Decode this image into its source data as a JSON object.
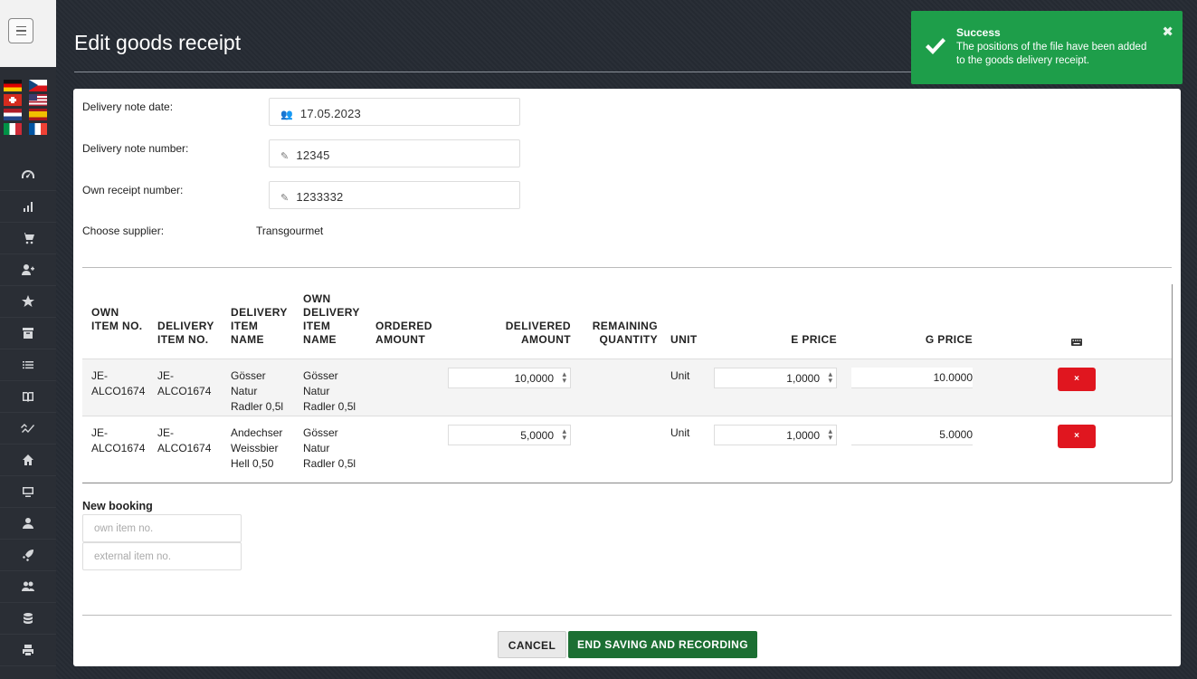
{
  "header": {
    "title": "Edit goods receipt"
  },
  "toast": {
    "title": "Success",
    "message": "The positions of the file have been added to the goods delivery receipt.",
    "close": "✖"
  },
  "sidebar": {
    "flags": [
      "de",
      "cz",
      "ch",
      "us",
      "nl",
      "es",
      "it",
      "fr"
    ],
    "icons": [
      "dashboard-icon",
      "chart-icon",
      "cart-icon",
      "add-user-icon",
      "star-icon",
      "archive-icon",
      "list-icon",
      "book-icon",
      "trend-icon",
      "home-icon",
      "monitor-icon",
      "user-icon",
      "rocket-icon",
      "users-icon",
      "database-icon",
      "print-icon"
    ]
  },
  "form": {
    "delivery_date_label": "Delivery note date:",
    "delivery_date_value": "17.05.2023",
    "delivery_number_label": "Delivery note number:",
    "delivery_number_value": "12345",
    "own_receipt_label": "Own receipt number:",
    "own_receipt_value": "1233332",
    "supplier_label": "Choose supplier:",
    "supplier_value": "Transgourmet"
  },
  "table": {
    "headers": {
      "own_item_no": "OWN ITEM NO.",
      "delivery_item_no": "DELIVERY ITEM NO.",
      "delivery_item_name": "DELIVERY ITEM NAME",
      "own_delivery_item_name": "OWN DELIVERY ITEM NAME",
      "ordered_amount": "ORDERED AMOUNT",
      "delivered_amount": "DELIVERED AMOUNT",
      "remaining_quantity": "REMAINING QUANTITY",
      "unit": "UNIT",
      "e_price": "E PRICE",
      "g_price": "G PRICE"
    },
    "rows": [
      {
        "own_item_no": "JE-ALCO1674",
        "delivery_item_no": "JE-ALCO1674",
        "delivery_item_name": "Gösser Natur Radler 0,5l",
        "own_delivery_item_name": "Gösser Natur Radler 0,5l",
        "delivered_amount": "10,0000",
        "unit": "Unit",
        "e_price": "1,0000",
        "g_price": "10.0000",
        "delete": "×"
      },
      {
        "own_item_no": "JE-ALCO1674",
        "delivery_item_no": "JE-ALCO1674",
        "delivery_item_name": "Andechser Weissbier Hell 0,50",
        "own_delivery_item_name": "Gösser Natur Radler 0,5l",
        "delivered_amount": "5,0000",
        "unit": "Unit",
        "e_price": "1,0000",
        "g_price": "5.0000",
        "delete": "×"
      }
    ]
  },
  "new_booking": {
    "label": "New booking",
    "own_item_placeholder": "own item no.",
    "external_item_placeholder": "external item no."
  },
  "actions": {
    "cancel": "CANCEL",
    "save": "END SAVING AND RECORDING"
  },
  "colors": {
    "success": "#1e9e4a",
    "danger": "#e0161f",
    "primary_button": "#1c6f33",
    "background": "#262b33"
  }
}
